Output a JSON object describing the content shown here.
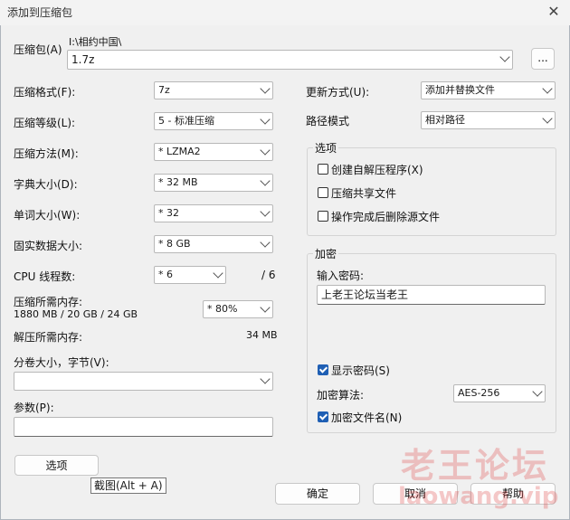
{
  "window": {
    "title": "添加到压缩包"
  },
  "archive": {
    "label": "压缩包(A)",
    "path": "I:\\相约中国\\",
    "name": "1.7z",
    "browse_label": "..."
  },
  "format": {
    "label": "压缩格式(F):",
    "value": "7z"
  },
  "level": {
    "label": "压缩等级(L):",
    "value": "5 - 标准压缩"
  },
  "method": {
    "label": "压缩方法(M):",
    "value": "* LZMA2"
  },
  "dict": {
    "label": "字典大小(D):",
    "value": "* 32 MB"
  },
  "word": {
    "label": "单词大小(W):",
    "value": "* 32"
  },
  "solid": {
    "label": "固实数据大小:",
    "value": "* 8 GB"
  },
  "threads": {
    "label": "CPU 线程数:",
    "value": "* 6",
    "max": "/ 6"
  },
  "memory": {
    "label": "压缩所需内存:",
    "detail": "1880 MB / 20 GB / 24 GB",
    "value": "* 80%"
  },
  "decomp": {
    "label": "解压所需内存:",
    "value": "34 MB"
  },
  "volume": {
    "label": "分卷大小，字节(V):",
    "value": ""
  },
  "params": {
    "label": "参数(P):",
    "value": ""
  },
  "options_button": "选项",
  "tooltip": "截图(Alt + A)",
  "update": {
    "label": "更新方式(U):",
    "value": "添加并替换文件"
  },
  "pathmode": {
    "label": "路径模式",
    "value": "相对路径"
  },
  "opts_group": {
    "title": "选项",
    "items": [
      {
        "label": "创建自解压程序(X)",
        "checked": false
      },
      {
        "label": "压缩共享文件",
        "checked": false
      },
      {
        "label": "操作完成后删除源文件",
        "checked": false
      }
    ]
  },
  "encrypt": {
    "title": "加密",
    "pw_label": "输入密码:",
    "password": "上老王论坛当老王",
    "show_pw": "显示密码(S)",
    "show_pw_checked": true,
    "algo_label": "加密算法:",
    "algo": "AES-256",
    "enc_names": "加密文件名(N)",
    "enc_names_checked": true
  },
  "buttons": {
    "ok": "确定",
    "cancel": "取消",
    "help": "帮助"
  },
  "watermark": {
    "line1": "老王论坛",
    "line2": "laowang.vip"
  }
}
